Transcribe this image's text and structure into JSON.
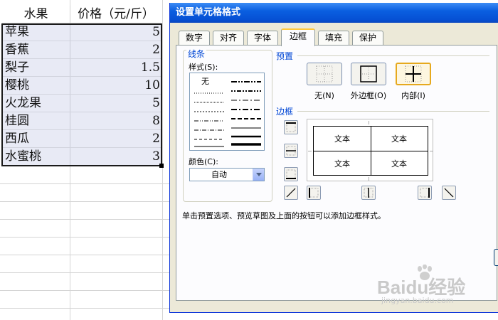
{
  "sheet": {
    "header": {
      "fruit": "水果",
      "price": "价格（元/斤）"
    },
    "rows": [
      {
        "fruit": "苹果",
        "price": "5"
      },
      {
        "fruit": "香蕉",
        "price": "2"
      },
      {
        "fruit": "梨子",
        "price": "1.5"
      },
      {
        "fruit": "樱桃",
        "price": "10"
      },
      {
        "fruit": "火龙果",
        "price": "5"
      },
      {
        "fruit": "桂圆",
        "price": "8"
      },
      {
        "fruit": "西瓜",
        "price": "2"
      },
      {
        "fruit": "水蜜桃",
        "price": "3"
      }
    ]
  },
  "dialog": {
    "title": "设置单元格格式",
    "tabs": [
      "数字",
      "对齐",
      "字体",
      "边框",
      "填充",
      "保护"
    ],
    "active_tab": "边框",
    "line_group": "线条",
    "style_label": "样式(S):",
    "style_none": "无",
    "color_label": "颜色(C):",
    "color_value": "自动",
    "presets_label": "预置",
    "presets": [
      "无(N)",
      "外边框(O)",
      "内部(I)"
    ],
    "border_label": "边框",
    "preview_texts": [
      "文本",
      "文本",
      "文本",
      "文本"
    ],
    "hint": "单击预置选项、预览草图及上面的按钮可以添加边框样式。"
  },
  "watermark": {
    "main": "Baidu经验",
    "sub": "jingyan.baidu.com"
  },
  "colors": {
    "title_bar": "#0a5fe0",
    "selection_fill": "#e8eaf5",
    "group_label": "#0046d5",
    "active_tab_accent": "#ffc83c"
  },
  "icons": [
    "preset-none-icon",
    "preset-outline-icon",
    "preset-inside-icon",
    "border-top-icon",
    "border-middle-h-icon",
    "border-bottom-icon",
    "border-diag-up-icon",
    "border-left-icon",
    "border-middle-v-icon",
    "border-right-icon",
    "border-diag-down-icon",
    "dropdown-arrow-icon",
    "baidu-paw-icon"
  ]
}
